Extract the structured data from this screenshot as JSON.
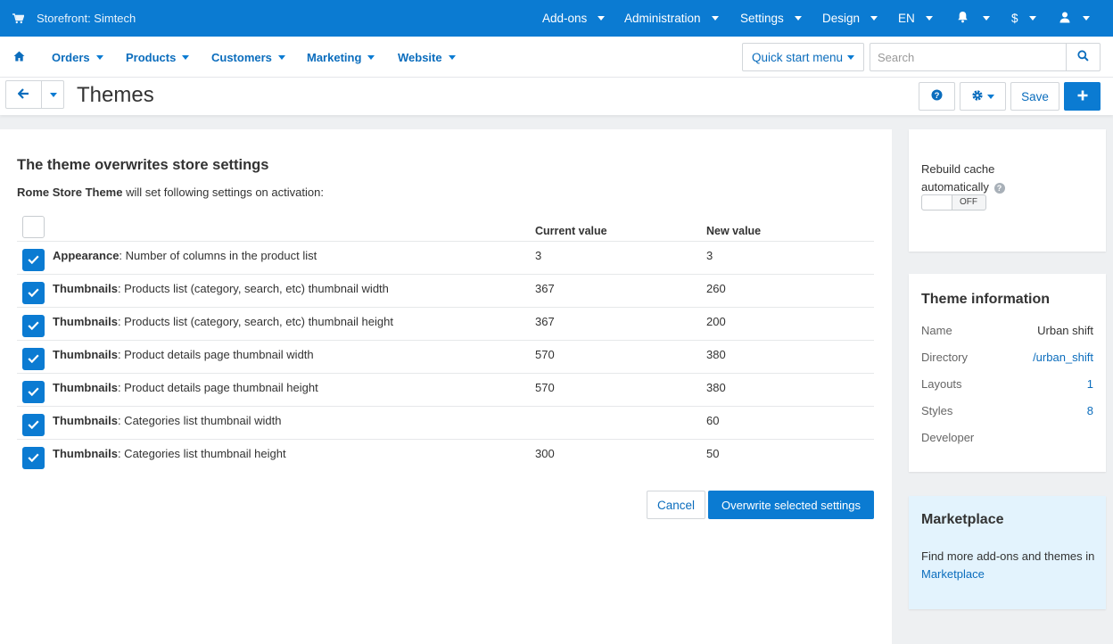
{
  "topbar": {
    "store_name": "Storefront: Simtech",
    "menu": [
      "Add-ons",
      "Administration",
      "Settings",
      "Design",
      "EN"
    ],
    "currency": "$"
  },
  "nav": {
    "items": [
      "Orders",
      "Products",
      "Customers",
      "Marketing",
      "Website"
    ],
    "quick_start": "Quick start menu",
    "search_placeholder": "Search"
  },
  "toolbar": {
    "title": "Themes",
    "save_label": "Save"
  },
  "main": {
    "heading": "The theme overwrites store settings",
    "intro_theme": "Rome Store Theme",
    "intro_rest": " will set following settings on activation:",
    "col_current": "Current value",
    "col_new": "New value",
    "rows": [
      {
        "group": "Appearance",
        "setting": ": Number of columns in the product list",
        "current": "3",
        "new": "3"
      },
      {
        "group": "Thumbnails",
        "setting": ": Products list (category, search, etc) thumbnail width",
        "current": "367",
        "new": "260"
      },
      {
        "group": "Thumbnails",
        "setting": ": Products list (category, search, etc) thumbnail height",
        "current": "367",
        "new": "200"
      },
      {
        "group": "Thumbnails",
        "setting": ": Product details page thumbnail width",
        "current": "570",
        "new": "380"
      },
      {
        "group": "Thumbnails",
        "setting": ": Product details page thumbnail height",
        "current": "570",
        "new": "380"
      },
      {
        "group": "Thumbnails",
        "setting": ": Categories list thumbnail width",
        "current": "",
        "new": "60"
      },
      {
        "group": "Thumbnails",
        "setting": ": Categories list thumbnail height",
        "current": "300",
        "new": "50"
      }
    ],
    "cancel_label": "Cancel",
    "overwrite_label": "Overwrite selected settings"
  },
  "sidebar": {
    "rebuild_label_1": "Rebuild cache",
    "rebuild_label_2": "automatically",
    "toggle_state": "OFF",
    "theme_info_title": "Theme information",
    "theme_info": [
      {
        "key": "Name",
        "value": "Urban shift"
      },
      {
        "key": "Directory",
        "value": "/urban_shift"
      },
      {
        "key": "Layouts",
        "value": "1"
      },
      {
        "key": "Styles",
        "value": "8"
      },
      {
        "key": "Developer",
        "value": ""
      }
    ],
    "marketplace_title": "Marketplace",
    "marketplace_text": "Find more add-ons and themes in ",
    "marketplace_link": "Marketplace"
  }
}
